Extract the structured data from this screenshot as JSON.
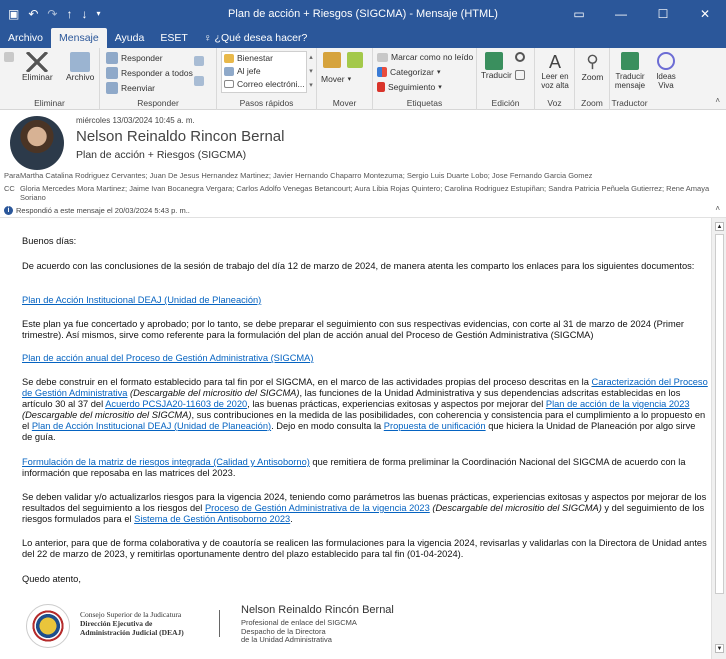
{
  "titlebar": {
    "title": "Plan de acción + Riesgos (SIGCMA)  -  Mensaje (HTML)"
  },
  "tabs": [
    "Archivo",
    "Mensaje",
    "Ayuda",
    "ESET",
    "¿Qué desea hacer?"
  ],
  "ribbon": {
    "eliminar": {
      "label": "Eliminar",
      "delete": "Eliminar",
      "archive": "Archivo"
    },
    "responder": {
      "label": "Responder",
      "reply": "Responder",
      "reply_all": "Responder a todos",
      "forward": "Reenviar"
    },
    "pasos": {
      "label": "Pasos rápidos",
      "items": [
        "Bienestar",
        "Al jefe",
        "Correo electróni..."
      ]
    },
    "mover": {
      "label": "Mover",
      "move": "Mover"
    },
    "etiquetas": {
      "label": "Etiquetas",
      "unread": "Marcar como no leído",
      "categorize": "Categorizar",
      "followup": "Seguimiento"
    },
    "edicion": {
      "label": "Edición",
      "translate": "Traducir"
    },
    "voz": {
      "label": "Voz",
      "read": "Leer en voz alta"
    },
    "zoom": {
      "label": "Zoom",
      "zoom": "Zoom"
    },
    "traductor": {
      "label": "Traductor",
      "translate_msg": "Traducir mensaje",
      "ideas": "Ideas Viva"
    }
  },
  "header": {
    "date": "miércoles 13/03/2024 10:45 a. m.",
    "sender": "Nelson Reinaldo Rincon Bernal",
    "subject": "Plan de acción + Riesgos (SIGCMA)",
    "to_label": "Para",
    "to": "Martha Catalina Rodriguez Cervantes; Juan De Jesus Hernandez Martinez; Javier Hernando Chaparro Montezuma; Sergio Luis Duarte Lobo; Jose Fernando Garcia Gomez",
    "cc_label": "CC",
    "cc": "Gloria Mercedes Mora Martinez; Jaime Ivan Bocanegra Vergara; Carlos Adolfo Venegas Betancourt; Aura Libia Rojas Quintero; Carolina Rodriguez Estupiñan; Sandra Patricia Peñuela Gutierrez; Rene Amaya Soriano",
    "info": "Respondió a este mensaje el 20/03/2024 5:43 p. m.."
  },
  "body": {
    "greeting": "Buenos días:",
    "p1": "De acuerdo con las conclusiones de la sesión de trabajo del día 12 de marzo de 2024, de manera atenta les comparto los enlaces para los siguientes documentos:",
    "link1": "Plan de Acción Institucional DEAJ (Unidad de Planeación)",
    "p2": "Este plan ya fue concertado y aprobado; por lo tanto, se debe preparar el seguimiento con sus respectivas evidencias, con corte al 31 de marzo de 2024 (Primer trimestre). Así mismos, sirve como referente para la formulación del plan de acción anual del Proceso de Gestión Administrativa (SIGCMA)",
    "link2": "Plan de acción anual del Proceso de Gestión Administrativa (SIGCMA)",
    "p3a": "Se debe construir en el formato establecido para tal fin por el SIGCMA, en el marco de las actividades propias del proceso descritas en la ",
    "p3_link1": "Caracterización del Proceso de Gestión Administrativa",
    "p3_it1": "(Descargable del micrositio del SIGCMA)",
    "p3b": ", las  funciones de la Unidad Administrativa y sus dependencias adscritas establecidas en los artículo 30 al 37 del ",
    "p3_link2": "Acuerdo PCSJA20-11603 de 2020",
    "p3c": ", las buenas prácticas, experiencias exitosas y aspectos por mejorar del ",
    "p3_link3": "Plan de acción de la vigencia 2023",
    "p3_it2": "(Descargable del micrositio del SIGCMA)",
    "p3d": ", sus contribuciones en la medida de las posibilidades, con coherencia y consistencia para el cumplimiento a lo propuesto en el ",
    "p3_link4": "Plan de Acción Institucional DEAJ (Unidad de Planeación)",
    "p3e": ". Dejo en modo consulta la ",
    "p3_link5": "Propuesta de unificación",
    "p3f": " que hiciera la Unidad de Planeación por algo sirve de guía.",
    "p4_link": "Formulación de la matriz de riesgos integrada (Calidad y Antisoborno)",
    "p4": " que remitiera de forma preliminar la Coordinación Nacional del SIGCMA de acuerdo con la información que reposaba en las matrices del 2023.",
    "p5a": "Se deben validar y/o actualizarlos riesgos para la vigencia 2024, teniendo como parámetros las buenas prácticas, experiencias exitosas y aspectos por mejorar de los resultados del seguimiento a los riesgos del ",
    "p5_link1": "Proceso de Gestión Administrativa de la vigencia 2023",
    "p5_it": "(Descargable del micrositio del SIGCMA)",
    "p5b": " y del seguimiento de los riesgos formulados para el ",
    "p5_link2": "Sistema de Gestión Antisoborno 2023",
    "p5c": ".",
    "p6": "Lo anterior, para que de forma colaborativa y de coautoría se realicen las formulaciones para la vigencia 2024, revisarlas y validarlas con la Directora de Unidad antes del 22 de marzo de 2023, y remitirlas oportunamente dentro del plazo establecido para tal fin (01-04-2024).",
    "closing": "Quedo atento,"
  },
  "signature": {
    "entity1": "Consejo Superior de la Judicatura",
    "entity2": "Dirección Ejecutiva de",
    "entity3": "Administración Judicial (DEAJ)",
    "name": "Nelson Reinaldo Rincón Bernal",
    "role1": "Profesional de enlace del SIGCMA",
    "role2": "Despacho de la Directora",
    "role3": "de la Unidad Administrativa"
  },
  "colors": {
    "accent": "#2b579a",
    "link": "#0563c1"
  }
}
